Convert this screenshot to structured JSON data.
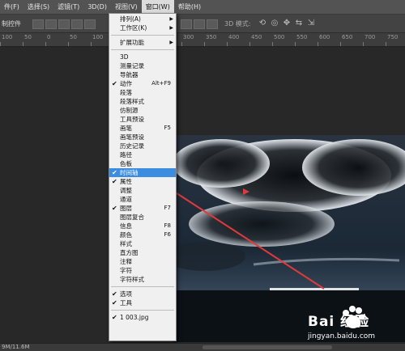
{
  "menubar": {
    "items": [
      "件(F)",
      "选择(S)",
      "滤镜(T)",
      "3D(D)",
      "视图(V)",
      "窗口(W)",
      "帮助(H)"
    ]
  },
  "options": {
    "tool_label": "制控件",
    "mode_label": "3D 模式:"
  },
  "ruler": {
    "ticks": [
      "100",
      "50",
      "0",
      "50",
      "100",
      "150",
      "200",
      "250",
      "300",
      "350",
      "400",
      "450",
      "500",
      "550",
      "600",
      "650",
      "700",
      "750"
    ]
  },
  "window_menu": {
    "items": [
      {
        "label": "排列(A)",
        "submenu": true
      },
      {
        "label": "工作区(K)",
        "submenu": true
      },
      {
        "sep": true
      },
      {
        "label": "扩展功能",
        "submenu": true
      },
      {
        "sep": true
      },
      {
        "label": "3D"
      },
      {
        "label": "测量记录"
      },
      {
        "label": "导航器"
      },
      {
        "label": "动作",
        "checked": true,
        "shortcut": "Alt+F9"
      },
      {
        "label": "段落"
      },
      {
        "label": "段落样式"
      },
      {
        "label": "仿制源"
      },
      {
        "label": "工具预设"
      },
      {
        "label": "画笔",
        "shortcut": "F5"
      },
      {
        "label": "画笔预设"
      },
      {
        "label": "历史记录"
      },
      {
        "label": "路径"
      },
      {
        "label": "色板"
      },
      {
        "label": "时间轴",
        "checked": true,
        "highlight": true
      },
      {
        "label": "属性",
        "checked": true
      },
      {
        "label": "调整"
      },
      {
        "label": "通道"
      },
      {
        "label": "图层",
        "checked": true,
        "shortcut": "F7"
      },
      {
        "label": "图层复合"
      },
      {
        "label": "信息",
        "shortcut": "F8"
      },
      {
        "label": "颜色",
        "shortcut": "F6"
      },
      {
        "label": "样式"
      },
      {
        "label": "直方图"
      },
      {
        "label": "注释"
      },
      {
        "label": "字符"
      },
      {
        "label": "字符样式"
      },
      {
        "sep": true
      },
      {
        "label": "选项",
        "checked": true
      },
      {
        "label": "工具",
        "checked": true
      },
      {
        "sep": true
      },
      {
        "label": "1 003.jpg",
        "checked": true
      }
    ]
  },
  "status": {
    "doc_size": "9M/11.6M"
  },
  "watermark": {
    "brand": "Bai 经验",
    "url": "jingyan.baidu.com"
  },
  "colors": {
    "highlight": "#3c8de0",
    "arrow": "#e23a3a"
  }
}
